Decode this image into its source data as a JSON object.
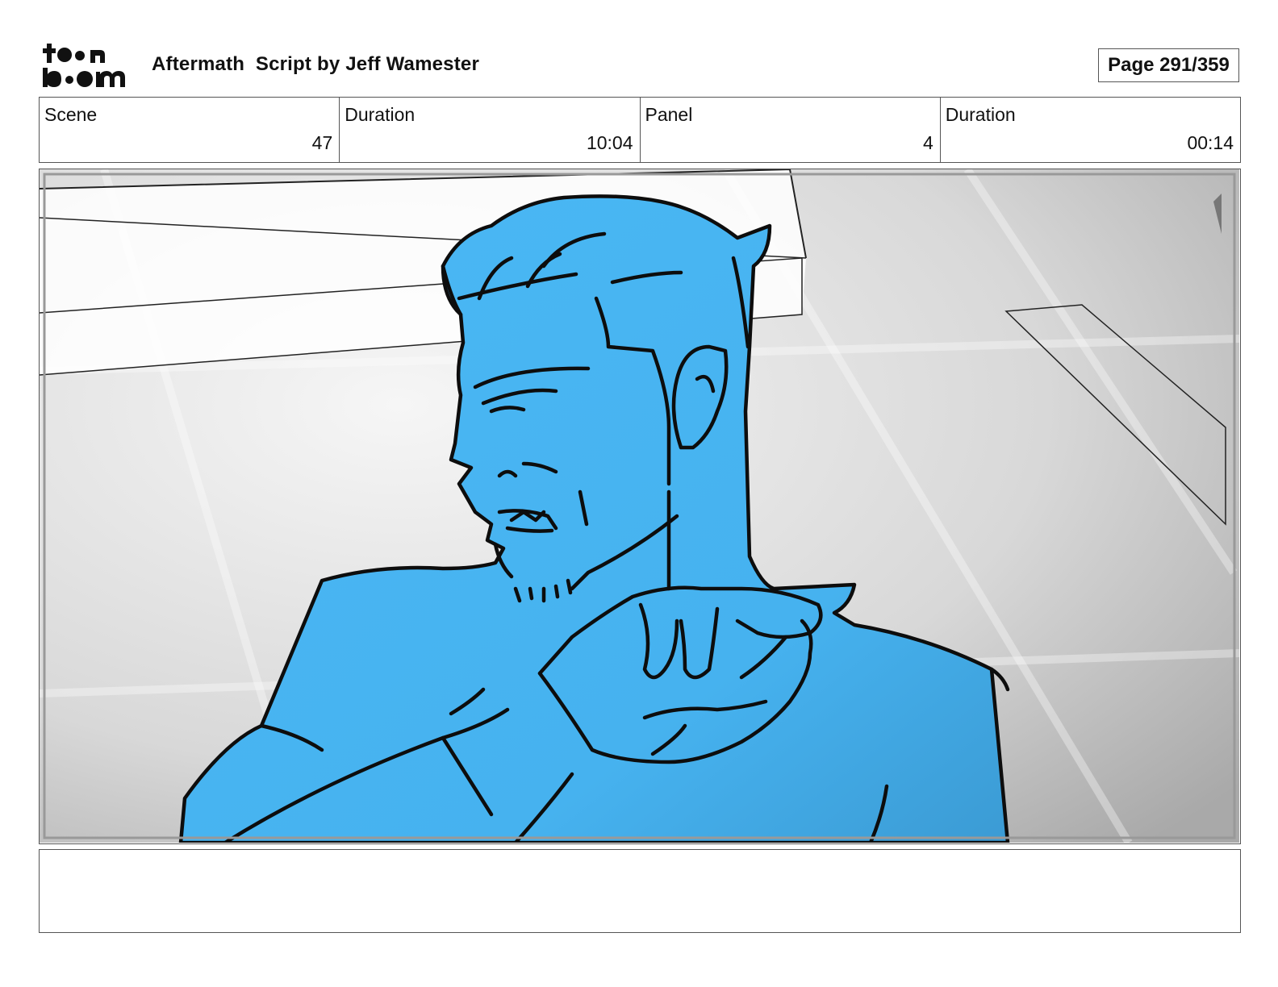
{
  "header": {
    "logo_text_top": "toon",
    "logo_text_bottom": "boom",
    "title": "Aftermath  Script by Jeff Wamester",
    "page_label": "Page 291/359"
  },
  "info": {
    "scene_label": "Scene",
    "scene_value": "47",
    "scene_duration_label": "Duration",
    "scene_duration_value": "10:04",
    "panel_label": "Panel",
    "panel_value": "4",
    "panel_duration_label": "Duration",
    "panel_duration_value": "00:14"
  },
  "panel": {
    "subject": "blue-figure-sketch",
    "fill_color": "#4ab8f5",
    "background_color": "#d9d9d9"
  },
  "notes": {
    "text": ""
  }
}
